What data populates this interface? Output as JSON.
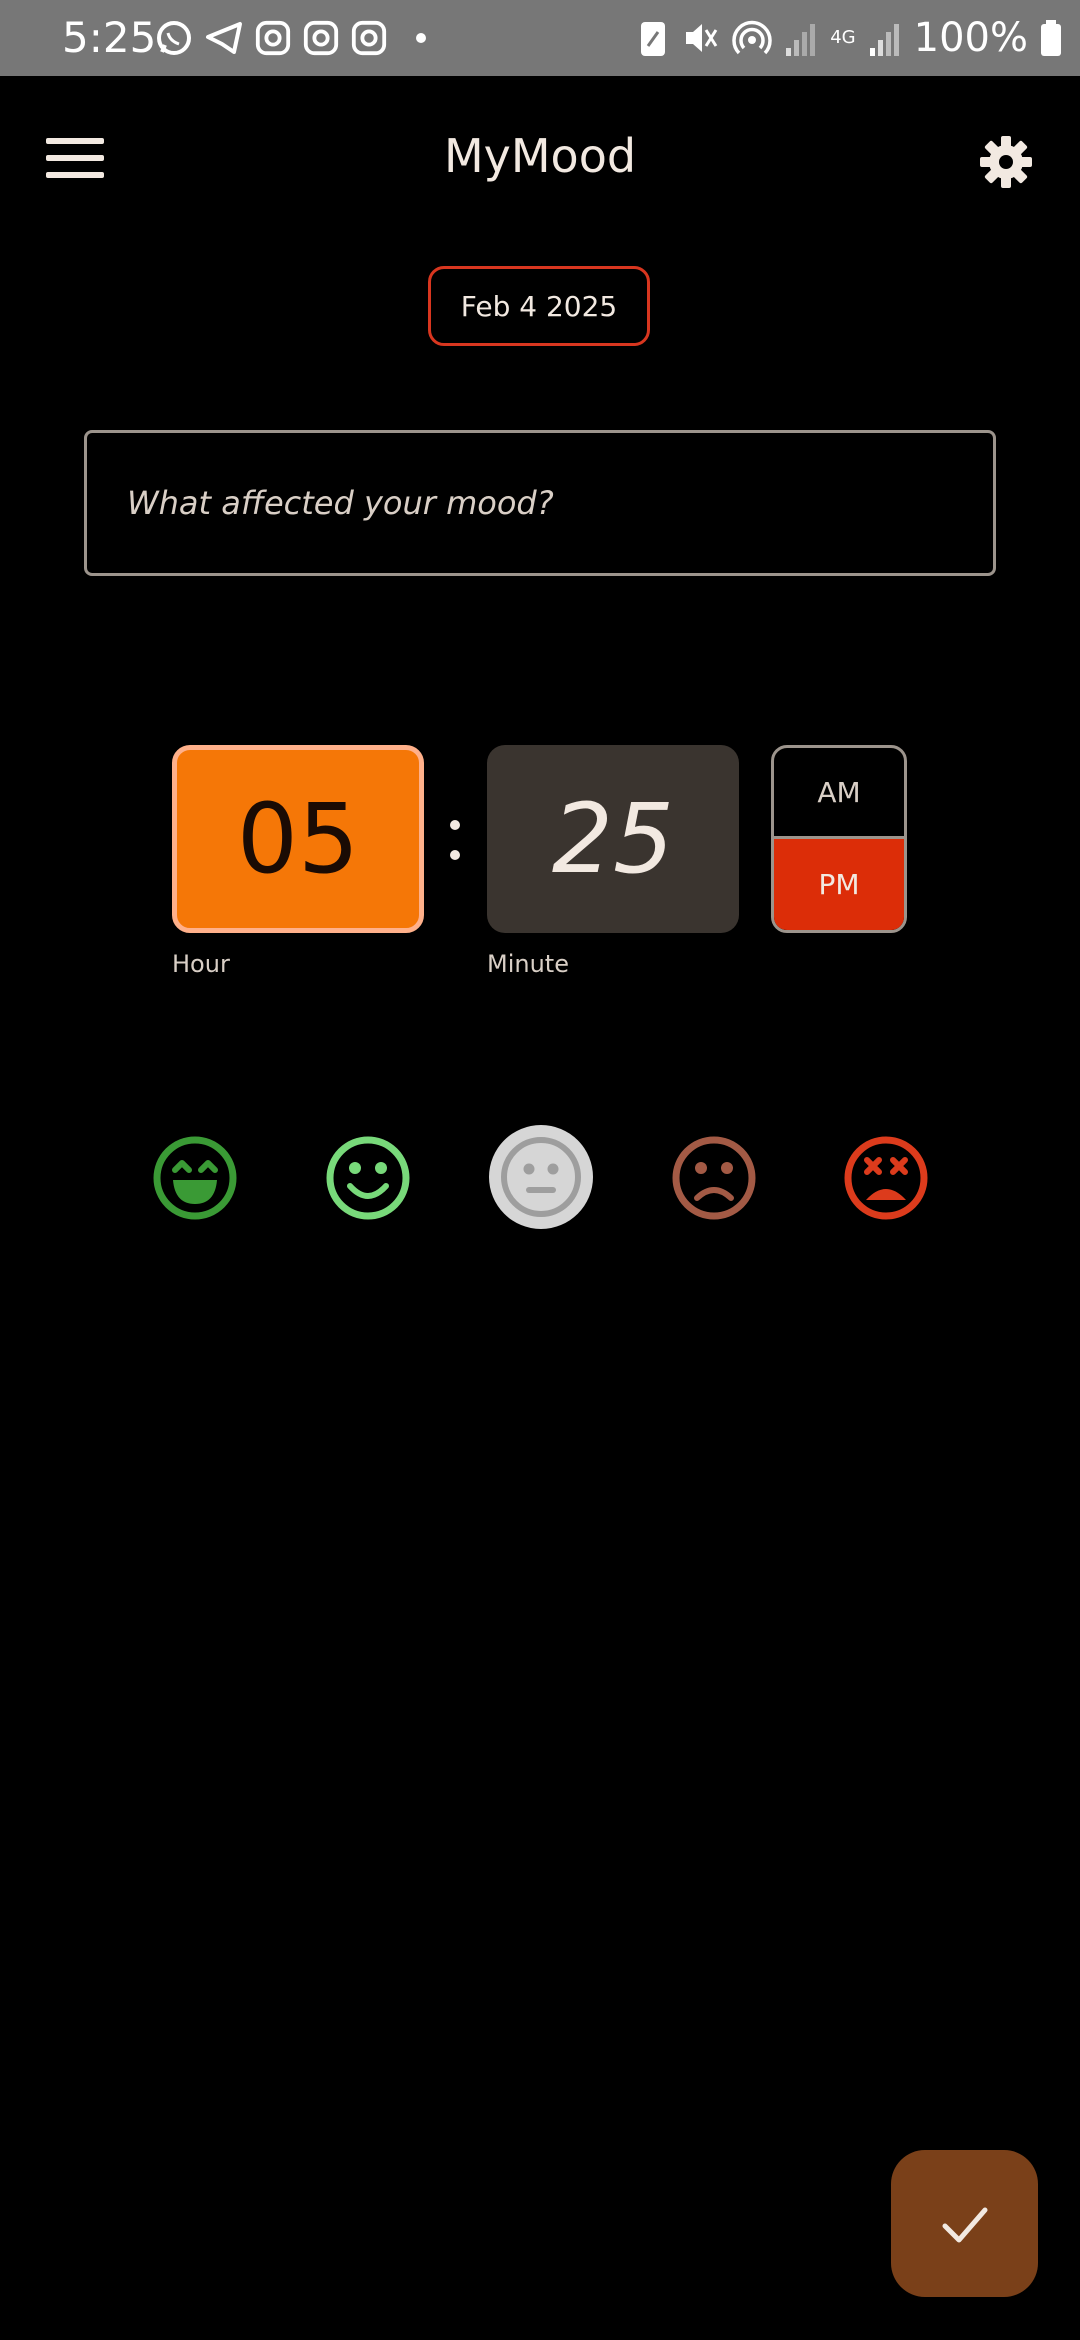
{
  "status_bar": {
    "time": "5:25",
    "battery": "100%",
    "network_label": "4G"
  },
  "app_bar": {
    "title": "MyMood",
    "menu_icon": "hamburger-menu-icon",
    "settings_icon": "gear-icon"
  },
  "date_chip": {
    "label": "Feb 4 2025"
  },
  "mood_input": {
    "placeholder": "What affected your mood?",
    "value": ""
  },
  "time_picker": {
    "hour": "05",
    "minute": "25",
    "hour_label": "Hour",
    "minute_label": "Minute",
    "am_label": "AM",
    "pm_label": "PM",
    "selected_period": "PM"
  },
  "moods": [
    {
      "name": "very-happy",
      "icon": "grinning-face-icon",
      "color": "#3a9a35"
    },
    {
      "name": "happy",
      "icon": "smiling-face-icon",
      "color": "#78d97a"
    },
    {
      "name": "neutral",
      "icon": "neutral-face-icon",
      "color": "#cfcfcf",
      "selected": true
    },
    {
      "name": "sad",
      "icon": "frowning-face-icon",
      "color": "#a35a45"
    },
    {
      "name": "very-sad",
      "icon": "dizzy-face-icon",
      "color": "#dc3b1c"
    }
  ],
  "save_button": {
    "icon": "checkmark-icon"
  },
  "colors": {
    "background": "#000000",
    "hour_box": "#f57707",
    "minute_box": "#3a342f",
    "pm_selected": "#dc2d08",
    "date_border": "#d8361f",
    "fab": "#7a4019"
  }
}
